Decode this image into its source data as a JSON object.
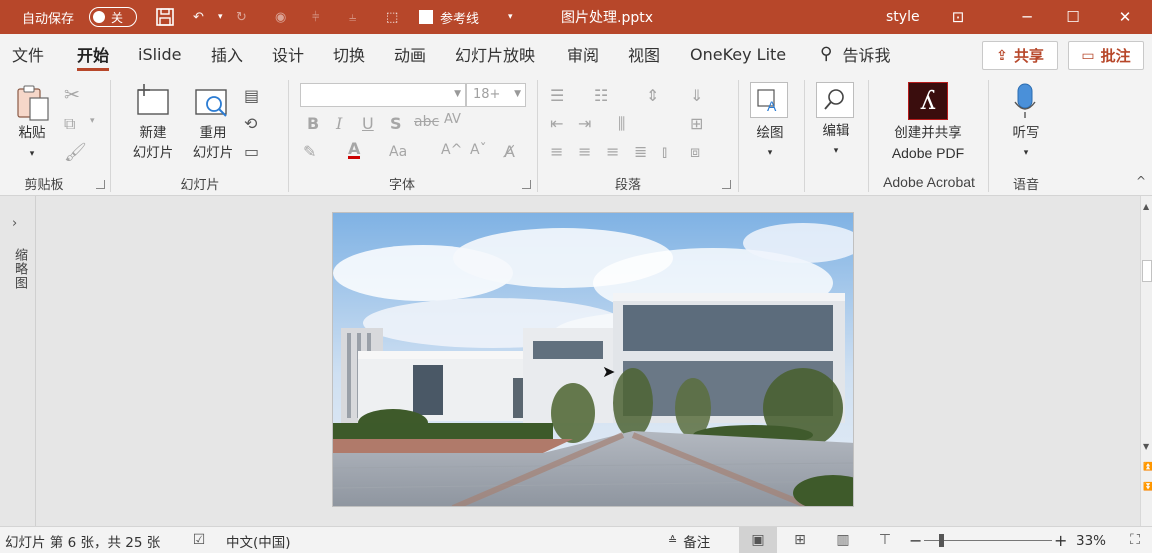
{
  "titlebar": {
    "autosave_label": "自动保存",
    "autosave_state": "关",
    "reference_label": "参考线",
    "filename": "图片处理.pptx",
    "user": "style",
    "bg_color": "#b7472a"
  },
  "tabs": [
    {
      "label": "文件"
    },
    {
      "label": "开始",
      "active": true
    },
    {
      "label": "iSlide"
    },
    {
      "label": "插入"
    },
    {
      "label": "设计"
    },
    {
      "label": "切换"
    },
    {
      "label": "动画"
    },
    {
      "label": "幻灯片放映"
    },
    {
      "label": "审阅"
    },
    {
      "label": "视图"
    },
    {
      "label": "OneKey Lite"
    }
  ],
  "tell_me": "告诉我",
  "share_label": "共享",
  "comment_label": "批注",
  "ribbon": {
    "clipboard": {
      "paste_label": "粘贴",
      "group_label": "剪贴板"
    },
    "slides": {
      "new_line1": "新建",
      "new_line2": "幻灯片",
      "reuse_line1": "重用",
      "reuse_line2": "幻灯片",
      "group_label": "幻灯片"
    },
    "font": {
      "font_size_placeholder": "18+",
      "group_label": "字体"
    },
    "paragraph": {
      "group_label": "段落"
    },
    "drawing": {
      "label": "绘图"
    },
    "editing": {
      "label": "编辑"
    },
    "acrobat": {
      "line1": "创建并共享",
      "line2": "Adobe PDF",
      "group_label": "Adobe Acrobat"
    },
    "voice": {
      "label": "听写",
      "group_label": "语音"
    }
  },
  "side_panel": {
    "label": "缩略图"
  },
  "statusbar": {
    "slide_info": "幻灯片 第 6 张，共 25 张",
    "language": "中文(中国)",
    "notes_label": "备注",
    "zoom_percent": "33%",
    "zoom_level": 0.33
  }
}
